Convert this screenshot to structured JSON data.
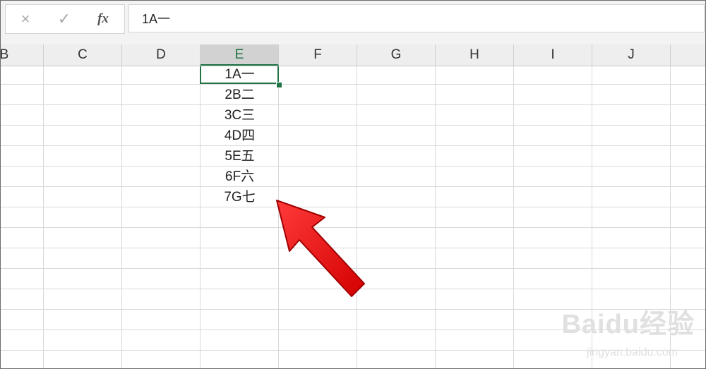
{
  "formula_bar": {
    "cancel_icon": "×",
    "enter_icon": "✓",
    "fx_label": "fx",
    "value": "1A一"
  },
  "columns": [
    "B",
    "C",
    "D",
    "E",
    "F",
    "G",
    "H",
    "I",
    "J"
  ],
  "selected_column": "E",
  "column_e_cells": [
    "1A一",
    "2B二",
    "3C三",
    "4D四",
    "5E五",
    "6F六",
    "7G七"
  ],
  "watermark": {
    "text": "Baidu经验",
    "url": "jingyan.baidu.com"
  }
}
